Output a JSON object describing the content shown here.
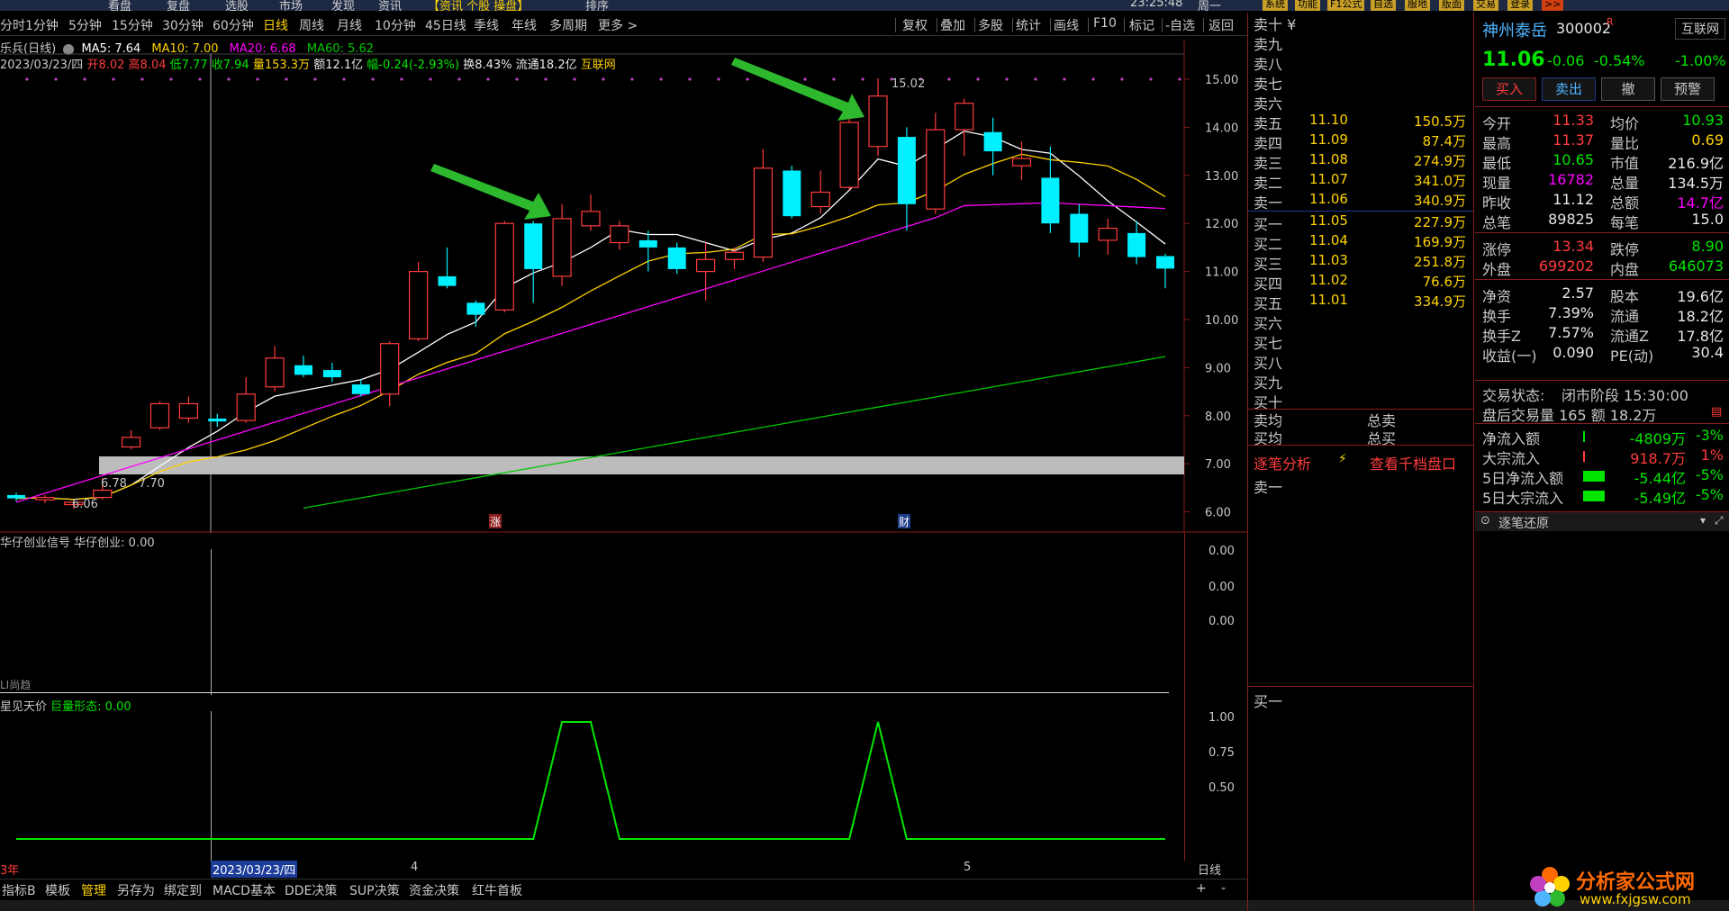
{
  "topbar": {
    "items": [
      "看盘",
      "复盘",
      "选股",
      "市场",
      "发现",
      "资讯",
      "【资讯 个股 操盘】",
      "排序"
    ],
    "clock": "23:25:48",
    "weekday": "周一",
    "buttons": [
      "系统",
      "功能",
      "F1公式",
      "自选",
      "服地",
      "版面",
      "交易",
      "登录"
    ],
    "more": ">>"
  },
  "period_bar": {
    "items": [
      "分时",
      "1分钟",
      "5分钟",
      "15分钟",
      "30分钟",
      "60分钟",
      "日线",
      "周线",
      "月线",
      "10分钟",
      "45日线",
      "季线",
      "年线",
      "多周期",
      "更多 >"
    ],
    "active": "日线",
    "right_items": [
      "复权",
      "叠加",
      "多股",
      "统计",
      "画线",
      "F10",
      "标记",
      "-自选",
      "返回"
    ]
  },
  "info_line1": {
    "name": "乐兵(日线)",
    "ma5": "MA5: 7.64",
    "ma10": "MA10: 7.00",
    "ma20": "MA20: 6.68",
    "ma60": "MA60: 5.62"
  },
  "info_line2": {
    "date": "2023/03/23/四",
    "open": "开8.02",
    "high": "高8.04",
    "low": "低7.77",
    "close": "收7.94",
    "volume": "量153.3万",
    "amount": "额12.1亿",
    "change": "幅-0.24(-2.93%)",
    "turnover": "换8.43%",
    "float": "流通18.2亿",
    "link": "互联网"
  },
  "main_chart": {
    "y_ticks": [
      "15.00",
      "14.00",
      "13.00",
      "12.00",
      "11.00",
      "10.00",
      "9.00",
      "8.00",
      "7.00",
      "6.00"
    ],
    "high_label": "15.02",
    "low_label": "6.06",
    "ma_label_a": "6.78",
    "ma_label_b": "7.70",
    "event_up": "涨",
    "event_fin": "财",
    "colors": {
      "up": "#ff3c3c",
      "down": "#00f0ff",
      "ma5": "#ffffff",
      "ma10": "#ffd200",
      "ma20": "#ff00ff",
      "ma60": "#00c800"
    }
  },
  "sub1": {
    "title": "华仔创业信号",
    "value": "华仔创业: 0.00",
    "y_ticks": [
      "0.00",
      "0.00",
      "0.00"
    ],
    "footnote": "LI尚趋"
  },
  "sub2": {
    "title": "星见天价",
    "value": "巨量形态: 0.00",
    "y_ticks": [
      "1.00",
      "0.75",
      "0.50"
    ],
    "chart_data": {
      "type": "line",
      "name": "巨量形态",
      "values": [
        0,
        0,
        0,
        0,
        0,
        0,
        0,
        0,
        0,
        0,
        0,
        0,
        0,
        0,
        0,
        0,
        0,
        0,
        0,
        1,
        1,
        0,
        0,
        0,
        0,
        0,
        0,
        0,
        0,
        0,
        1,
        0,
        0,
        0,
        0,
        0,
        0,
        0,
        0,
        0,
        0
      ]
    }
  },
  "bottom_date": {
    "year": "3年",
    "cursor_date": "2023/03/23/四",
    "m4": "4",
    "m5": "5",
    "period": "日线"
  },
  "toolbar": {
    "items": [
      "指标B",
      "模板",
      "管理",
      "另存为",
      "绑定到",
      "MACD基本",
      "DDE决策",
      "SUP决策",
      "资金决策",
      "红牛首板"
    ],
    "active": "管理",
    "right": [
      "+",
      "-"
    ]
  },
  "orderbook": {
    "header": "卖十 ¥",
    "sells": [
      {
        "label": "卖九",
        "price": "",
        "vol": ""
      },
      {
        "label": "卖八",
        "price": "",
        "vol": ""
      },
      {
        "label": "卖七",
        "price": "",
        "vol": ""
      },
      {
        "label": "卖六",
        "price": "",
        "vol": ""
      },
      {
        "label": "卖五",
        "price": "11.10",
        "vol": "150.5万"
      },
      {
        "label": "卖四",
        "price": "11.09",
        "vol": "87.4万"
      },
      {
        "label": "卖三",
        "price": "11.08",
        "vol": "274.9万"
      },
      {
        "label": "卖二",
        "price": "11.07",
        "vol": "341.0万"
      },
      {
        "label": "卖一",
        "price": "11.06",
        "vol": "340.9万"
      }
    ],
    "buys": [
      {
        "label": "买一",
        "price": "11.05",
        "vol": "227.9万"
      },
      {
        "label": "买二",
        "price": "11.04",
        "vol": "169.9万"
      },
      {
        "label": "买三",
        "price": "11.03",
        "vol": "251.8万"
      },
      {
        "label": "买四",
        "price": "11.02",
        "vol": "76.6万"
      },
      {
        "label": "买五",
        "price": "11.01",
        "vol": "334.9万"
      },
      {
        "label": "买六",
        "price": "",
        "vol": ""
      },
      {
        "label": "买七",
        "price": "",
        "vol": ""
      },
      {
        "label": "买八",
        "price": "",
        "vol": ""
      },
      {
        "label": "买九",
        "price": "",
        "vol": ""
      },
      {
        "label": "买十",
        "price": "",
        "vol": ""
      }
    ],
    "sell_avg": "卖均",
    "buy_avg": "买均",
    "total_sell": "总卖",
    "total_buy": "总买",
    "tick_analysis": "逐笔分析",
    "view_depth": "查看千档盘口",
    "buy1_a": "卖一",
    "buy1_b": "买一"
  },
  "quote": {
    "name": "神州泰岳",
    "code": "300002",
    "badge": "R",
    "sector": "互联网",
    "price": "11.06",
    "change": "-0.06",
    "change_pct": "-0.54%",
    "sector_pct": "-1.00%",
    "buttons": [
      "买入",
      "卖出",
      "撤",
      "预警"
    ],
    "rows": [
      {
        "a": "今开",
        "av": "11.33",
        "ac": "red",
        "b": "均价",
        "bv": "10.93",
        "bc": "green"
      },
      {
        "a": "最高",
        "av": "11.37",
        "ac": "red",
        "b": "量比",
        "bv": "0.69",
        "bc": "yellow"
      },
      {
        "a": "最低",
        "av": "10.65",
        "ac": "green",
        "b": "市值",
        "bv": "216.9亿",
        "bc": "white"
      },
      {
        "a": "现量",
        "av": "16782",
        "ac": "magenta",
        "b": "总量",
        "bv": "134.5万",
        "bc": "white"
      },
      {
        "a": "昨收",
        "av": "11.12",
        "ac": "white",
        "b": "总额",
        "bv": "14.7亿",
        "bc": "magenta"
      },
      {
        "a": "总笔",
        "av": "89825",
        "ac": "white",
        "b": "每笔",
        "bv": "15.0",
        "bc": "white"
      }
    ],
    "rows2": [
      {
        "a": "涨停",
        "av": "13.34",
        "ac": "red",
        "b": "跌停",
        "bv": "8.90",
        "bc": "green"
      },
      {
        "a": "外盘",
        "av": "699202",
        "ac": "red",
        "b": "内盘",
        "bv": "646073",
        "bc": "green"
      }
    ],
    "rows3": [
      {
        "a": "净资",
        "av": "2.57",
        "ac": "white",
        "b": "股本",
        "bv": "19.6亿",
        "bc": "white"
      },
      {
        "a": "换手",
        "av": "7.39%",
        "ac": "white",
        "b": "流通",
        "bv": "18.2亿",
        "bc": "white"
      },
      {
        "a": "换手Z",
        "av": "7.57%",
        "ac": "white",
        "b": "流通Z",
        "bv": "17.8亿",
        "bc": "white"
      },
      {
        "a": "收益(一)",
        "av": "0.090",
        "ac": "white",
        "b": "PE(动)",
        "bv": "30.4",
        "bc": "white"
      }
    ],
    "trade_state_label": "交易状态:",
    "trade_state": "闭市阶段 15:30:00",
    "after_hours": "盘后交易量 165 额 18.2万",
    "flows": [
      {
        "label": "净流入额",
        "val": "-4809万",
        "pct": "-3%",
        "vc": "green"
      },
      {
        "label": "大宗流入",
        "val": "918.7万",
        "pct": "1%",
        "vc": "red"
      },
      {
        "label": "5日净流入额",
        "val": "-5.44亿",
        "pct": "-5%",
        "vc": "green"
      },
      {
        "label": "5日大宗流入",
        "val": "-5.49亿",
        "pct": "-5%",
        "vc": "green"
      }
    ],
    "tick_restore": "逐笔还原",
    "watermark_cn": "分析家公式网",
    "watermark_url": "www.fxjgsw.com"
  }
}
